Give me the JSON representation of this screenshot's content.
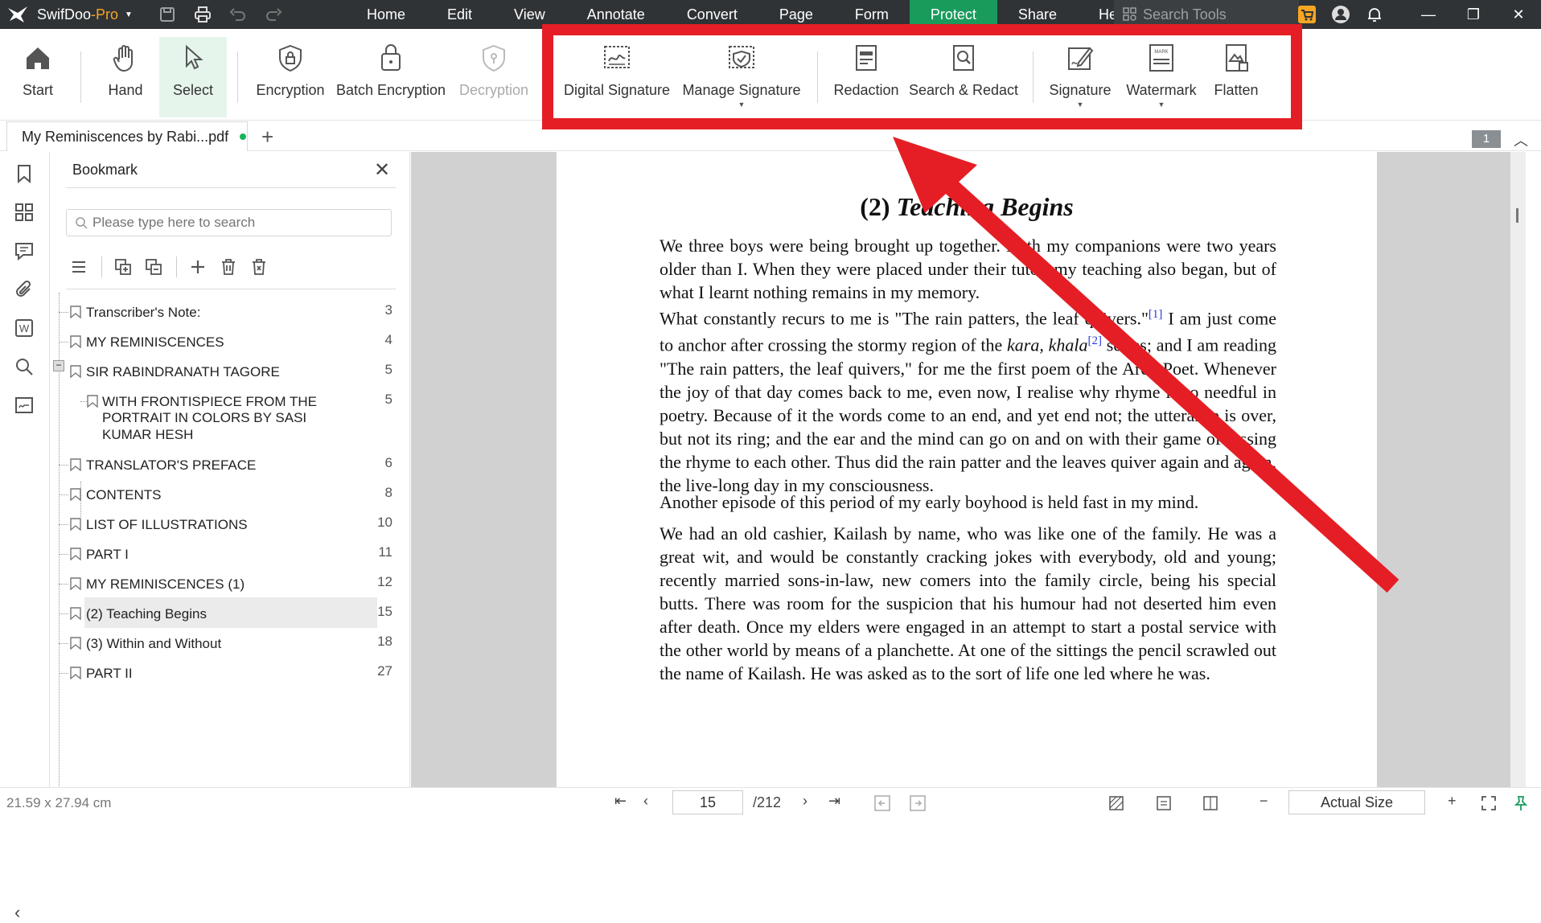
{
  "app": {
    "name_prefix": "SwifDoo",
    "name_suffix": "-Pro",
    "brand_color": "#f5a623",
    "accent_color": "#199b5c"
  },
  "menu": {
    "items": [
      "Home",
      "Edit",
      "View",
      "Annotate",
      "Convert",
      "Page",
      "Form",
      "Protect",
      "Share",
      "Help"
    ],
    "active": "Protect",
    "search_tools_placeholder": "Search Tools"
  },
  "ribbon": {
    "start": "Start",
    "hand": "Hand",
    "select": "Select",
    "encryption": "Encryption",
    "batch_encryption": "Batch Encryption",
    "decryption": "Decryption",
    "digital_signature": "Digital Signature",
    "manage_signature": "Manage Signature",
    "redaction": "Redaction",
    "search_redact": "Search & Redact",
    "signature": "Signature",
    "watermark": "Watermark",
    "flatten": "Flatten"
  },
  "tabs": {
    "doc_tab_label": "My Reminiscences by Rabi...pdf",
    "page_badge": "1"
  },
  "bookmark_panel": {
    "title": "Bookmark",
    "search_placeholder": "Please type here to search",
    "items": [
      {
        "label": "Transcriber's Note:",
        "page": "3"
      },
      {
        "label": "MY REMINISCENCES",
        "page": "4"
      },
      {
        "label": "SIR RABINDRANATH TAGORE",
        "page": "5"
      },
      {
        "label_lines": [
          "WITH FRONTISPIECE FROM THE",
          "PORTRAIT IN COLORS BY SASI",
          "KUMAR HESH"
        ],
        "page": "5"
      },
      {
        "label": "TRANSLATOR'S PREFACE",
        "page": "6"
      },
      {
        "label": "CONTENTS",
        "page": "8"
      },
      {
        "label": "LIST OF ILLUSTRATIONS",
        "page": "10"
      },
      {
        "label": "PART I",
        "page": "11"
      },
      {
        "label": "MY REMINISCENCES (1)",
        "page": "12"
      },
      {
        "label": "(2) Teaching Begins",
        "page": "15"
      },
      {
        "label": "(3) Within and Without",
        "page": "18"
      },
      {
        "label": "PART II",
        "page": "27"
      }
    ]
  },
  "document": {
    "title_num": "(2) ",
    "title_text": "Teaching Begins",
    "p1": "We three boys were being brought up together. Both my companions were two years older than I. When they were placed under their tutor, my teaching also began, but of what I learnt nothing remains in my memory.",
    "p2a": "What constantly recurs to me is \"The rain patters, the leaf quivers.\"",
    "p2_ref1": "[1]",
    "p2b": " I am just come to anchor after crossing the stormy region of the ",
    "p2_kara": "kara, khala",
    "p2_ref2": "[2]",
    "p2c": " series; and I am reading \"The rain patters, the leaf quivers,\" for me the first poem of the Arch Poet. Whenever the joy of that day comes back to me, even now, I realise why rhyme is so needful in poetry. Because of it the words come to an end, and yet end not; the utterance is over, but not its ring; and the ear and the mind can go on and on with their game of tossing the rhyme to each other. Thus did the rain patter and the leaves quiver again and again, the live-long day in my consciousness.",
    "p3": "Another episode of this period of my early boyhood is held fast in my mind.",
    "p4": "We had an old cashier, Kailash by name, who was like one of the family. He was a great wit, and would be constantly cracking jokes with everybody, old and young; recently married sons-in-law, new comers into the family circle, being his special butts. There was room for the suspicion that his humour had not deserted him even after death. Once my elders were engaged in an attempt to start a postal service with the other world by means of a planchette. At one of the sittings the pencil scrawled out the name of Kailash. He was asked as to the sort of life one led where he was."
  },
  "status": {
    "dims": "21.59 x 27.94 cm",
    "current_page": "15",
    "total_pages": "/212",
    "zoom": "Actual Size"
  }
}
